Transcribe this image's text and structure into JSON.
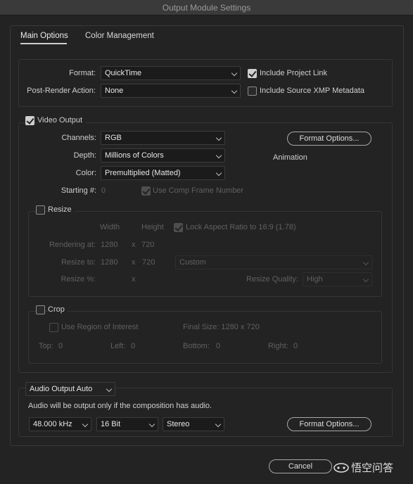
{
  "window": {
    "title": "Output Module Settings"
  },
  "tabs": [
    {
      "label": "Main Options"
    },
    {
      "label": "Color Management"
    }
  ],
  "format": {
    "label": "Format:",
    "value": "QuickTime"
  },
  "post_render": {
    "label": "Post-Render Action:",
    "value": "None"
  },
  "include_project_link": {
    "label": "Include Project Link",
    "checked": true
  },
  "include_xmp": {
    "label": "Include Source XMP Metadata",
    "checked": false
  },
  "video_output": {
    "label": "Video Output",
    "checked": true,
    "channels": {
      "label": "Channels:",
      "value": "RGB"
    },
    "depth": {
      "label": "Depth:",
      "value": "Millions of Colors"
    },
    "color": {
      "label": "Color:",
      "value": "Premultiplied (Matted)"
    },
    "starting": {
      "label": "Starting #:",
      "value": "0"
    },
    "use_comp_frame": {
      "label": "Use Comp Frame Number",
      "checked": true
    },
    "format_options_button": "Format Options...",
    "codec": "Animation"
  },
  "resize": {
    "label": "Resize",
    "checked": false,
    "width_header": "Width",
    "height_header": "Height",
    "lock_aspect": {
      "label": "Lock Aspect Ratio to 16:9 (1.78)",
      "checked": true
    },
    "rendering_at": {
      "label": "Rendering at:",
      "width": "1280",
      "x": "x",
      "height": "720"
    },
    "resize_to": {
      "label": "Resize to:",
      "width": "1280",
      "x": "x",
      "height": "720",
      "preset": "Custom"
    },
    "resize_pct": {
      "label": "Resize %:",
      "x": "x"
    },
    "quality": {
      "label": "Resize Quality:",
      "value": "High"
    }
  },
  "crop": {
    "label": "Crop",
    "checked": false,
    "use_roi": {
      "label": "Use Region of Interest",
      "checked": false
    },
    "final_size": "Final Size: 1280 x 720",
    "top": {
      "label": "Top:",
      "value": "0"
    },
    "left": {
      "label": "Left:",
      "value": "0"
    },
    "bottom": {
      "label": "Bottom:",
      "value": "0"
    },
    "right": {
      "label": "Right:",
      "value": "0"
    }
  },
  "audio": {
    "mode": "Audio Output Auto",
    "note": "Audio will be output only if the composition has audio.",
    "rate": "48.000 kHz",
    "bits": "16 Bit",
    "channels": "Stereo",
    "format_options_button": "Format Options..."
  },
  "footer": {
    "cancel": "Cancel",
    "watermark": "悟空问答"
  }
}
